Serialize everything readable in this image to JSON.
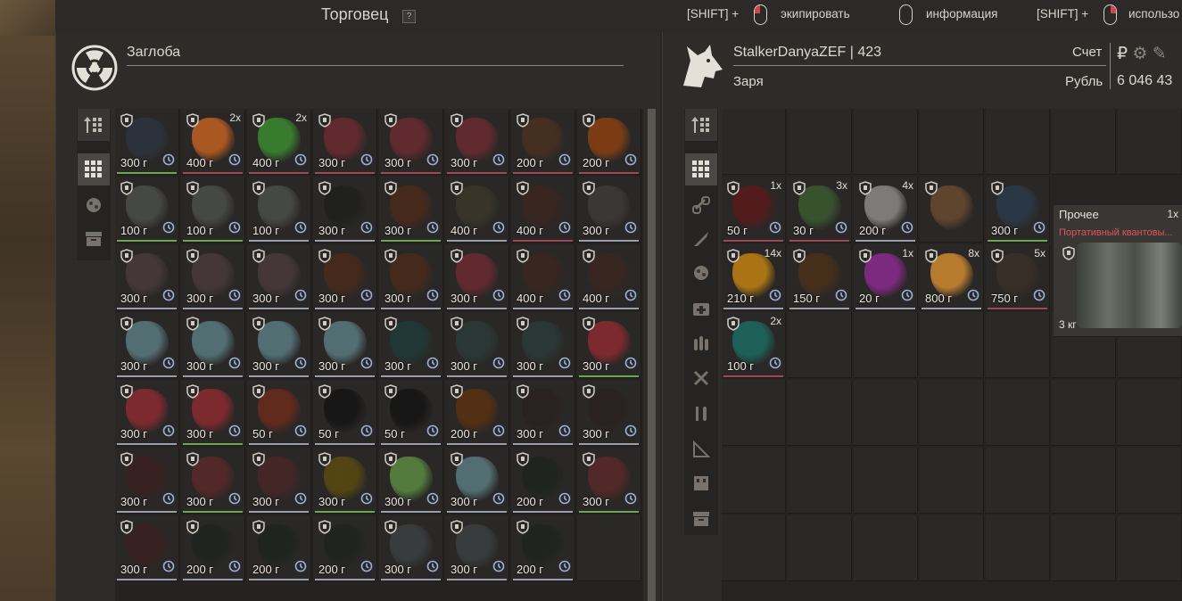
{
  "header": {
    "trader_title": "Торговец",
    "help": "?",
    "hints": [
      {
        "prefix": "[SHIFT] +",
        "label": "экипировать",
        "button": "left"
      },
      {
        "prefix": "",
        "label": "информация",
        "button": "none"
      },
      {
        "prefix": "[SHIFT] +",
        "label": "использо",
        "button": "right"
      }
    ]
  },
  "trader": {
    "name": "Заглоба",
    "items": [
      {
        "w": "300 г",
        "q": "",
        "c": "#2d3440",
        "b": "#6aa84f"
      },
      {
        "w": "400 г",
        "q": "2x",
        "c": "#c06020",
        "b": "#a04858"
      },
      {
        "w": "400 г",
        "q": "2x",
        "c": "#3a8a30",
        "b": "#a04858"
      },
      {
        "w": "300 г",
        "q": "",
        "c": "#6b2a30",
        "b": "#a04858"
      },
      {
        "w": "300 г",
        "q": "",
        "c": "#6b2a30",
        "b": "#a04858"
      },
      {
        "w": "300 г",
        "q": "",
        "c": "#6b2a30",
        "b": "#a04858"
      },
      {
        "w": "200 г",
        "q": "",
        "c": "#4a3020",
        "b": "#a04858"
      },
      {
        "w": "200 г",
        "q": "",
        "c": "#8a4010",
        "b": "#a04858"
      },
      {
        "w": "100 г",
        "q": "",
        "c": "#4a4d48",
        "b": "#6aa84f"
      },
      {
        "w": "100 г",
        "q": "",
        "c": "#4a4d48",
        "b": "#6aa84f"
      },
      {
        "w": "100 г",
        "q": "",
        "c": "#4a4d48",
        "b": "#9aa0aa"
      },
      {
        "w": "300 г",
        "q": "",
        "c": "#1e201e",
        "b": "#9aa0aa"
      },
      {
        "w": "300 г",
        "q": "",
        "c": "#4a2a1a",
        "b": "#6aa84f"
      },
      {
        "w": "400 г",
        "q": "",
        "c": "#3a3628",
        "b": "#9aa0aa"
      },
      {
        "w": "400 г",
        "q": "",
        "c": "#3a2520",
        "b": "#a04858"
      },
      {
        "w": "300 г",
        "q": "",
        "c": "#3e3a3a",
        "b": "#9aa0aa"
      },
      {
        "w": "300 г",
        "q": "",
        "c": "#4a3a3c",
        "b": "#9aa0aa"
      },
      {
        "w": "300 г",
        "q": "",
        "c": "#4a3a3c",
        "b": "#9aa0aa"
      },
      {
        "w": "300 г",
        "q": "",
        "c": "#4a3a3c",
        "b": "#9aa0aa"
      },
      {
        "w": "300 г",
        "q": "",
        "c": "#4a2a1a",
        "b": "#9aa0aa"
      },
      {
        "w": "300 г",
        "q": "",
        "c": "#4a2a1a",
        "b": "#9aa0aa"
      },
      {
        "w": "300 г",
        "q": "",
        "c": "#6b2a30",
        "b": "#9aa0aa"
      },
      {
        "w": "400 г",
        "q": "",
        "c": "#3a2520",
        "b": "#9aa0aa"
      },
      {
        "w": "400 г",
        "q": "",
        "c": "#3a2520",
        "b": "#9aa0aa"
      },
      {
        "w": "300 г",
        "q": "",
        "c": "#5a7a80",
        "b": "#9aa0aa"
      },
      {
        "w": "300 г",
        "q": "",
        "c": "#5a7a80",
        "b": "#9aa0aa"
      },
      {
        "w": "300 г",
        "q": "",
        "c": "#5a7a80",
        "b": "#9aa0aa"
      },
      {
        "w": "300 г",
        "q": "",
        "c": "#5a7a80",
        "b": "#9aa0aa"
      },
      {
        "w": "300 г",
        "q": "",
        "c": "#1f3a38",
        "b": "#9aa0aa"
      },
      {
        "w": "300 г",
        "q": "",
        "c": "#2a3a38",
        "b": "#9aa0aa"
      },
      {
        "w": "300 г",
        "q": "",
        "c": "#2a3a38",
        "b": "#9aa0aa"
      },
      {
        "w": "300 г",
        "q": "",
        "c": "#8a2a30",
        "b": "#6aa84f"
      },
      {
        "w": "300 г",
        "q": "",
        "c": "#8a2a30",
        "b": "#9aa0aa"
      },
      {
        "w": "300 г",
        "q": "",
        "c": "#8a2a30",
        "b": "#6aa84f"
      },
      {
        "w": "50 г",
        "q": "",
        "c": "#6a2a1a",
        "b": "#9aa0aa"
      },
      {
        "w": "50 г",
        "q": "",
        "c": "#141414",
        "b": "#9aa0aa"
      },
      {
        "w": "50 г",
        "q": "",
        "c": "#141414",
        "b": "#9aa0aa"
      },
      {
        "w": "200 г",
        "q": "",
        "c": "#5a3010",
        "b": "#9aa0aa"
      },
      {
        "w": "300 г",
        "q": "",
        "c": "#2a2020",
        "b": "#9aa0aa"
      },
      {
        "w": "300 г",
        "q": "",
        "c": "#2a2020",
        "b": "#9aa0aa"
      },
      {
        "w": "300 г",
        "q": "",
        "c": "#3a2020",
        "b": "#9aa0aa"
      },
      {
        "w": "300 г",
        "q": "",
        "c": "#5a2828",
        "b": "#6aa84f"
      },
      {
        "w": "300 г",
        "q": "",
        "c": "#4a2626",
        "b": "#9aa0aa"
      },
      {
        "w": "300 г",
        "q": "",
        "c": "#5a4a10",
        "b": "#6aa84f"
      },
      {
        "w": "300 г",
        "q": "",
        "c": "#5a8a40",
        "b": "#9aa0aa"
      },
      {
        "w": "300 г",
        "q": "",
        "c": "#5a7a80",
        "b": "#9aa0aa"
      },
      {
        "w": "200 г",
        "q": "",
        "c": "#1e2420",
        "b": "#9aa0aa"
      },
      {
        "w": "300 г",
        "q": "",
        "c": "#5a2828",
        "b": "#6aa84f"
      },
      {
        "w": "300 г",
        "q": "",
        "c": "#3a2020",
        "b": "#9aa0aa"
      },
      {
        "w": "200 г",
        "q": "",
        "c": "#1e2420",
        "b": "#9aa0aa"
      },
      {
        "w": "200 г",
        "q": "",
        "c": "#1e2420",
        "b": "#9aa0aa"
      },
      {
        "w": "200 г",
        "q": "",
        "c": "#1e2420",
        "b": "#9aa0aa"
      },
      {
        "w": "300 г",
        "q": "",
        "c": "#3a4040",
        "b": "#9aa0aa"
      },
      {
        "w": "300 г",
        "q": "",
        "c": "#3a4040",
        "b": "#9aa0aa"
      },
      {
        "w": "200 г",
        "q": "",
        "c": "#1e2420",
        "b": "#9aa0aa"
      }
    ]
  },
  "player": {
    "name": "StalkerDanyaZEF | 423",
    "faction": "Заря",
    "account_label": "Счет",
    "currency_label": "Рубль",
    "balance": "6 046 43",
    "items": [
      {
        "w": "50 г",
        "q": "1x",
        "c": "#5a1a1a",
        "b": "#a04858",
        "col": 0,
        "row": 1
      },
      {
        "w": "30 г",
        "q": "3x",
        "c": "#3a5a30",
        "b": "#a04858",
        "col": 1,
        "row": 1
      },
      {
        "w": "200 г",
        "q": "4x",
        "c": "#8a8a86",
        "b": "#9aa0aa",
        "col": 2,
        "row": 1
      },
      {
        "w": "",
        "q": "",
        "c": "#6a4a30",
        "b": "",
        "col": 3,
        "row": 1
      },
      {
        "w": "300 г",
        "q": "",
        "c": "#2a3a4a",
        "b": "#6aa84f",
        "col": 4,
        "row": 1
      },
      {
        "w": "210 г",
        "q": "14x",
        "c": "#c08010",
        "b": "#9aa0aa",
        "col": 0,
        "row": 2
      },
      {
        "w": "150 г",
        "q": "",
        "c": "#4a3018",
        "b": "#9aa0aa",
        "col": 1,
        "row": 2
      },
      {
        "w": "20 г",
        "q": "1x",
        "c": "#8a2a90",
        "b": "#9aa0aa",
        "col": 2,
        "row": 2
      },
      {
        "w": "800 г",
        "q": "8x",
        "c": "#d08a30",
        "b": "#9aa0aa",
        "col": 3,
        "row": 2
      },
      {
        "w": "750 г",
        "q": "5x",
        "c": "#3a3028",
        "b": "#a04858",
        "col": 4,
        "row": 2
      },
      {
        "w": "100 г",
        "q": "2x",
        "c": "#1a6a60",
        "b": "#a04858",
        "col": 0,
        "row": 3
      }
    ],
    "featured": {
      "category": "Прочее",
      "qty": "1x",
      "name": "Портативный квантовы...",
      "weight": "3 кг"
    }
  },
  "colors": {
    "accent_red": "#e0555a",
    "border_green": "#6aa84f",
    "border_red": "#a04858"
  }
}
